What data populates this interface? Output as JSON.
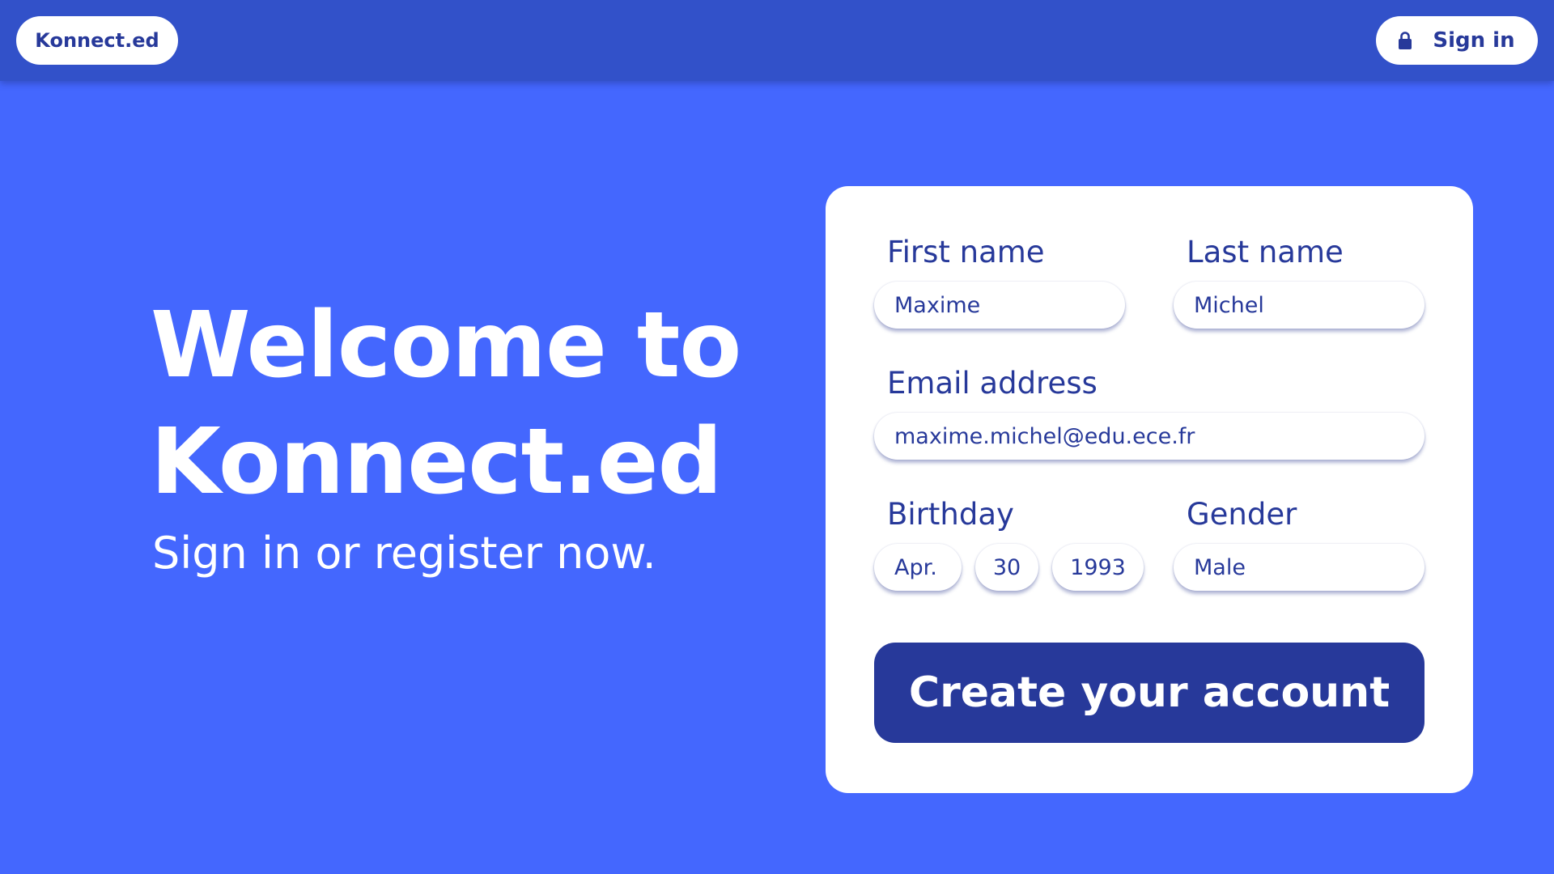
{
  "header": {
    "logo_text": "Konnect.ed",
    "signin_label": "Sign in",
    "signin_icon": "lock-icon"
  },
  "hero": {
    "title_line1": "Welcome to",
    "title_line2": "Konnect.ed",
    "subtitle": "Sign in or register now."
  },
  "form": {
    "first_name": {
      "label": "First name",
      "value": "Maxime"
    },
    "last_name": {
      "label": "Last name",
      "value": "Michel"
    },
    "email": {
      "label": "Email address",
      "value": "maxime.michel@edu.ece.fr"
    },
    "birthday": {
      "label": "Birthday",
      "month": "Apr.",
      "day": "30",
      "year": "1993"
    },
    "gender": {
      "label": "Gender",
      "value": "Male"
    },
    "submit_label": "Create your account"
  },
  "colors": {
    "background": "#4467FE",
    "topbar": "#3251C9",
    "primary_dark": "#27399A",
    "card": "#FFFFFF"
  }
}
